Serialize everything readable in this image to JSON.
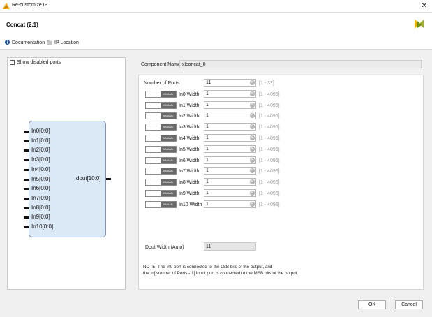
{
  "window": {
    "title": "Re-customize IP",
    "close_glyph": "✕",
    "app_icon": "xilinx-app-icon"
  },
  "header": {
    "ip_title": "Concat (2.1)",
    "logo": "xilinx-logo"
  },
  "links": {
    "documentation": "Documentation",
    "ip_location": "IP Location"
  },
  "left_panel": {
    "show_disabled_label": "Show disabled ports",
    "input_ports": [
      "In0[0:0]",
      "In1[0:0]",
      "In2[0:0]",
      "In3[0:0]",
      "In4[0:0]",
      "In5[0:0]",
      "In6[0:0]",
      "In7[0:0]",
      "In8[0:0]",
      "In9[0:0]",
      "In10[0:0]"
    ],
    "output_port": "dout[10:0]"
  },
  "component": {
    "label": "Component Name",
    "value": "xlconcat_0"
  },
  "config": {
    "num_ports": {
      "label": "Number of Ports",
      "value": "11",
      "range": "[1 - 32]"
    },
    "manual_label": "MANUAL",
    "widths": [
      {
        "label": "In0 Width",
        "value": "1",
        "range": "[1 - 4096]"
      },
      {
        "label": "In1 Width",
        "value": "1",
        "range": "[1 - 4096]"
      },
      {
        "label": "In2 Width",
        "value": "1",
        "range": "[1 - 4096]"
      },
      {
        "label": "In3 Width",
        "value": "1",
        "range": "[1 - 4096]"
      },
      {
        "label": "In4 Width",
        "value": "1",
        "range": "[1 - 4096]"
      },
      {
        "label": "In5 Width",
        "value": "1",
        "range": "[1 - 4096]"
      },
      {
        "label": "In6 Width",
        "value": "1",
        "range": "[1 - 4096]"
      },
      {
        "label": "In7 Width",
        "value": "1",
        "range": "[1 - 4096]"
      },
      {
        "label": "In8 Width",
        "value": "1",
        "range": "[1 - 4096]"
      },
      {
        "label": "In9 Width",
        "value": "1",
        "range": "[1 - 4096]"
      },
      {
        "label": "In10 Width",
        "value": "1",
        "range": "[1 - 4096]"
      }
    ],
    "dout_width": {
      "label": "Dout Width (Auto)",
      "value": "11"
    },
    "note_line1": "NOTE: The In0 port is connected to the LSB bits of the output, and",
    "note_line2": "the In[Number of Ports - 1] input port is connected to the MSB bits of the output."
  },
  "buttons": {
    "ok": "OK",
    "cancel": "Cancel"
  }
}
